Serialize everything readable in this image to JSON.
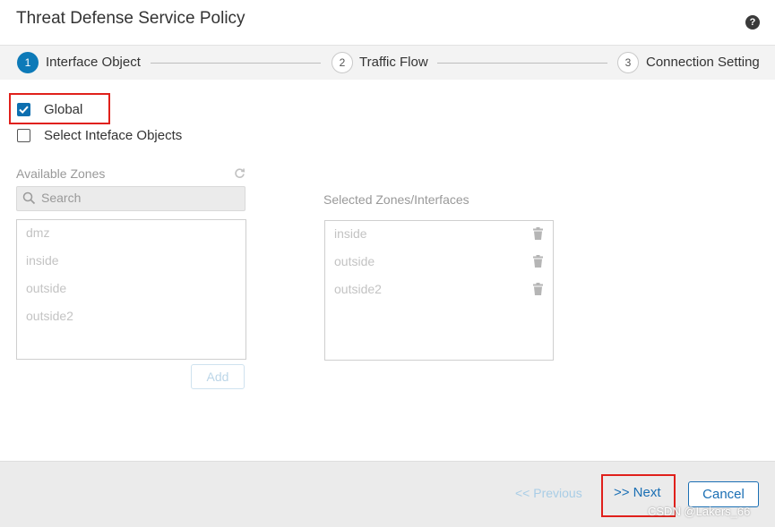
{
  "dialog": {
    "title": "Threat Defense Service Policy",
    "help_icon": "?"
  },
  "wizard": {
    "steps": [
      {
        "number": "1",
        "label": "Interface Object",
        "active": true
      },
      {
        "number": "2",
        "label": "Traffic Flow",
        "active": false
      },
      {
        "number": "3",
        "label": "Connection Setting",
        "active": false
      }
    ]
  },
  "scope": {
    "global_label": "Global",
    "global_checked": true,
    "select_label": "Select Inteface Objects",
    "select_checked": false
  },
  "available": {
    "label": "Available Zones",
    "search_placeholder": "Search",
    "items": [
      "dmz",
      "inside",
      "outside",
      "outside2"
    ],
    "add_label": "Add"
  },
  "selected": {
    "label": "Selected Zones/Interfaces",
    "items": [
      "inside",
      "outside",
      "outside2"
    ]
  },
  "footer": {
    "previous_label": "<< Previous",
    "next_label": ">> Next",
    "cancel_label": "Cancel"
  },
  "watermark": "CSDN @Lakers_66",
  "colors": {
    "accent": "#0d7ab8",
    "highlight": "#e0201b",
    "button_text": "#1a6fb4"
  }
}
